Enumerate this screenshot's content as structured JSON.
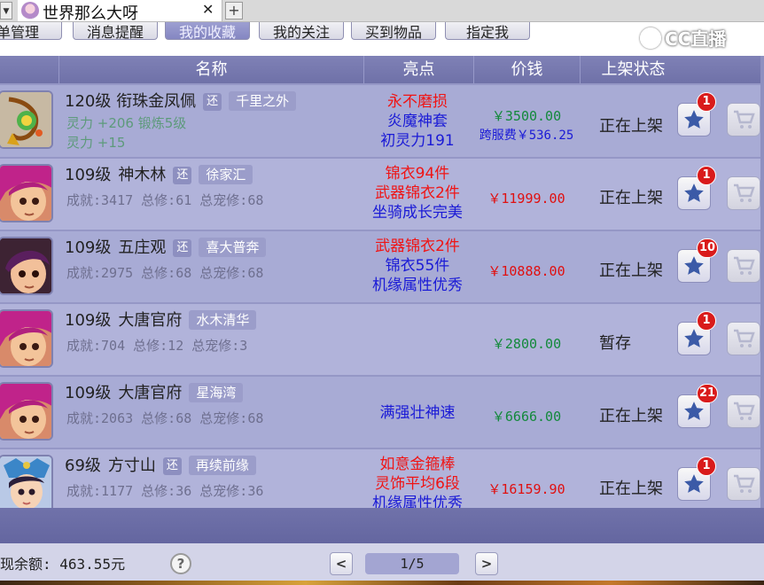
{
  "window": {
    "tab_title": "世界那么大呀",
    "tab_close": "✕",
    "tab_add": "+",
    "tab_left": "▼"
  },
  "nav": {
    "items": [
      {
        "label": "菜单管理"
      },
      {
        "label": "消息提醒"
      },
      {
        "label": "我的收藏",
        "active": true
      },
      {
        "label": "我的关注"
      },
      {
        "label": "买到物品"
      },
      {
        "label": "指定我"
      }
    ]
  },
  "logo": {
    "text": "CC直播"
  },
  "table": {
    "headers": {
      "name": "名称",
      "highlight": "亮点",
      "price": "价钱",
      "status": "上架状态"
    },
    "rows": [
      {
        "level_name": "120级 衔珠金凤佩",
        "huan": "还",
        "server": "千里之外",
        "attr1": "灵力 +206 锻炼5级",
        "attr2": "灵力 +15",
        "highlights": [
          {
            "text": "永不磨损",
            "color": "red"
          },
          {
            "text": "炎魔神套",
            "color": "blue"
          },
          {
            "text": "初灵力191",
            "color": "blue"
          }
        ],
        "price": "￥3500.00",
        "price_color": "green",
        "cross_price": "跨服费￥536.25",
        "status": "正在上架",
        "badge": "1"
      },
      {
        "level": "109级",
        "school": "神木林",
        "huan": "还",
        "server": "徐家汇",
        "stats": "成就:3417 总修:61 总宠修:68",
        "highlights": [
          {
            "text": "锦衣94件",
            "color": "red"
          },
          {
            "text": "武器锦衣2件",
            "color": "red"
          },
          {
            "text": "坐骑成长完美",
            "color": "blue"
          }
        ],
        "price": "￥11999.00",
        "price_color": "red",
        "status": "正在上架",
        "badge": "1"
      },
      {
        "level": "109级",
        "school": "五庄观",
        "huan": "还",
        "server": "喜大普奔",
        "stats": "成就:2975 总修:68 总宠修:68",
        "highlights": [
          {
            "text": "武器锦衣2件",
            "color": "red"
          },
          {
            "text": "锦衣55件",
            "color": "blue"
          },
          {
            "text": "机缘属性优秀",
            "color": "blue"
          }
        ],
        "price": "￥10888.00",
        "price_color": "red",
        "status": "正在上架",
        "badge": "10"
      },
      {
        "level": "109级",
        "school": "大唐官府",
        "server": "水木清华",
        "stats": "成就:704 总修:12 总宠修:3",
        "highlights": [],
        "price": "￥2800.00",
        "price_color": "green",
        "status": "暂存",
        "badge": "1"
      },
      {
        "level": "109级",
        "school": "大唐官府",
        "server": "星海湾",
        "stats": "成就:2063 总修:68 总宠修:68",
        "highlights": [
          {
            "text": "满强壮神速",
            "color": "blue"
          }
        ],
        "price": "￥6666.00",
        "price_color": "green",
        "status": "正在上架",
        "badge": "21"
      },
      {
        "level": "69级",
        "school": "方寸山",
        "huan": "还",
        "server": "再续前缘",
        "stats": "成就:1177 总修:36 总宠修:36",
        "highlights": [
          {
            "text": "如意金箍棒",
            "color": "red"
          },
          {
            "text": "灵饰平均6段",
            "color": "red"
          },
          {
            "text": "机缘属性优秀",
            "color": "blue"
          }
        ],
        "price": "￥16159.90",
        "price_color": "red",
        "status": "正在上架",
        "badge": "1"
      }
    ]
  },
  "footer": {
    "balance": "现余额: 463.55元",
    "help": "?",
    "prev": "<",
    "page": "1/5",
    "next": ">"
  },
  "icons": [
    "star-icon",
    "cart-icon",
    "help-icon",
    "chevron-left-icon",
    "chevron-right-icon",
    "close-icon",
    "plus-icon"
  ]
}
